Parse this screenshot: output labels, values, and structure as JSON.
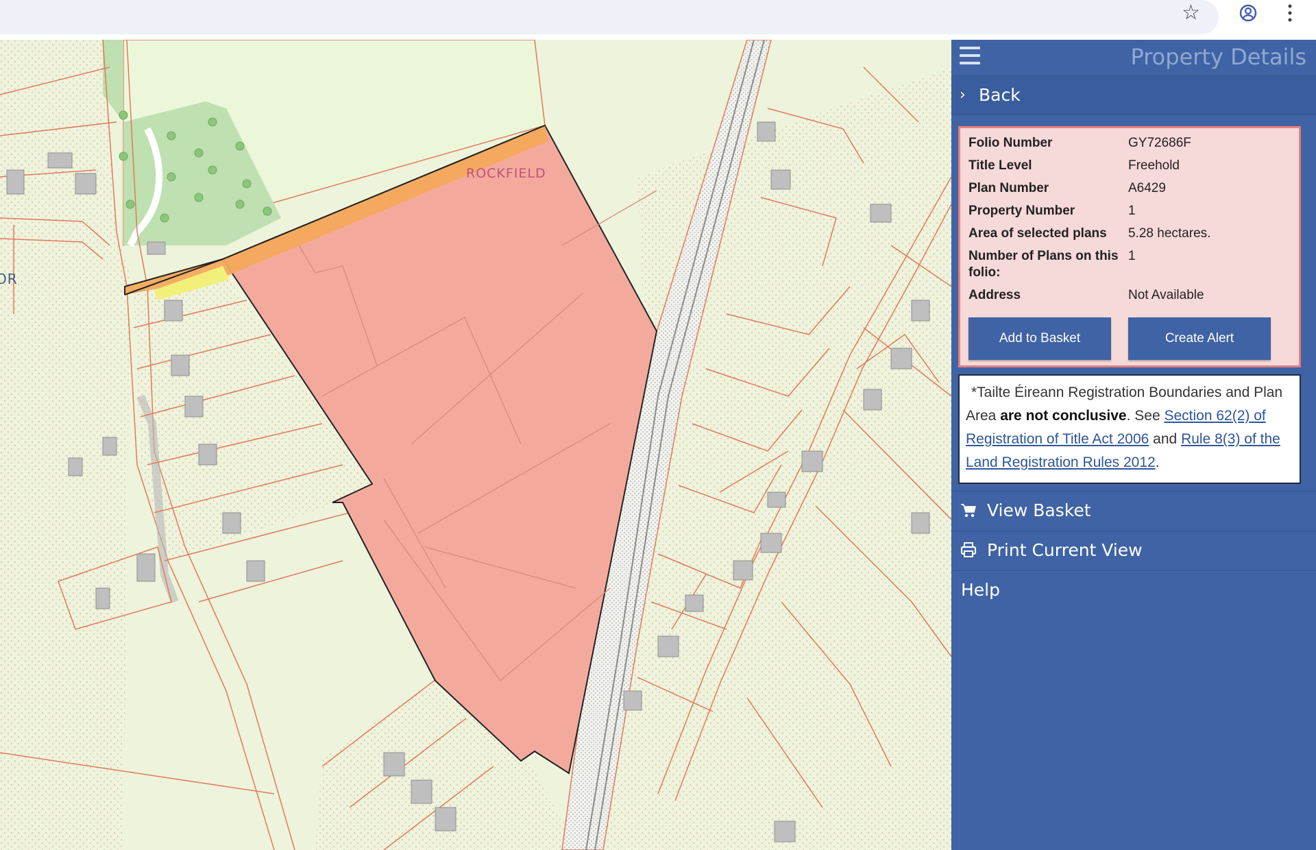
{
  "browser": {
    "icons": [
      "star-icon",
      "profile-icon",
      "more-vert-icon"
    ]
  },
  "map": {
    "labels": {
      "rockfield": "ROCKFIELD",
      "partial_left": "OR"
    },
    "colors": {
      "base": "#eef3dc",
      "field": "#ecf7da",
      "woodland": "#bfe0b0",
      "boundary": "#e07a5a",
      "selected_plan": "#f3aa9d",
      "highlight": "#f3a95c"
    }
  },
  "panel": {
    "title": "Property Details",
    "back_label": "Back",
    "details": {
      "folio_number_label": "Folio Number",
      "folio_number": "GY72686F",
      "title_level_label": "Title Level",
      "title_level": "Freehold",
      "plan_number_label": "Plan Number",
      "plan_number": "A6429",
      "property_number_label": "Property Number",
      "property_number": "1",
      "area_label": "Area of selected plans",
      "area": "5.28 hectares.",
      "num_plans_label": "Number of Plans on this folio:",
      "num_plans": "1",
      "address_label": "Address",
      "address": "Not Available"
    },
    "buttons": {
      "add_to_basket": "Add to Basket",
      "create_alert": "Create Alert"
    },
    "disclaimer": {
      "lead": "*Tailte Éireann Registration Boundaries and Plan Area",
      "bold": "are not conclusive",
      "see": ". See",
      "link1": "Section 62(2) of Registration of Title Act 2006",
      "and": "and",
      "link2": "Rule 8(3) of the Land Registration Rules 2012",
      "end": "."
    },
    "menu": {
      "view_basket": "View Basket",
      "print_current_view": "Print Current View",
      "help": "Help"
    },
    "colors": {
      "panel_bg": "#3f63a4",
      "details_bg": "#f6d9d9",
      "details_border": "#e57f7f"
    }
  }
}
